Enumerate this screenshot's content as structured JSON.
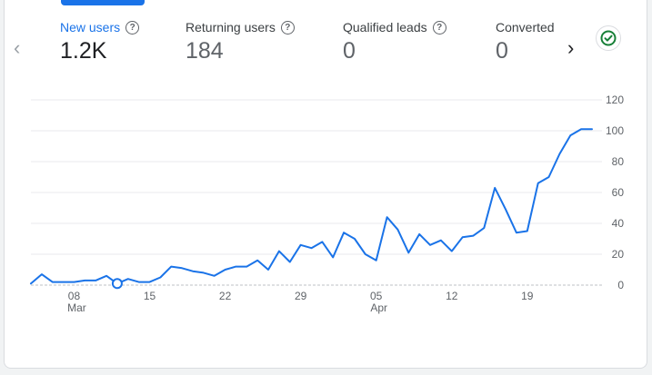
{
  "tabs": [
    {
      "label": "New users",
      "value": "1.2K",
      "active": true
    },
    {
      "label": "Returning users",
      "value": "184",
      "active": false
    },
    {
      "label": "Qualified leads",
      "value": "0",
      "active": false
    },
    {
      "label": "Converted",
      "value": "0",
      "active": false
    }
  ],
  "icons": {
    "prev": "chevron-left-icon",
    "next": "chevron-right-icon",
    "help": "help-circle-icon",
    "status": "check-circle-icon"
  },
  "colors": {
    "accent": "#1a73e8",
    "status": "#188038",
    "grid": "#e8eaed"
  },
  "chart_data": {
    "type": "line",
    "title": "",
    "xlabel": "",
    "ylabel": "",
    "ylim": [
      0,
      120
    ],
    "yticks": [
      0,
      20,
      40,
      60,
      80,
      100,
      120
    ],
    "y_axis_side": "right",
    "grid": true,
    "x": [
      "2024-03-04",
      "2024-03-05",
      "2024-03-06",
      "2024-03-07",
      "2024-03-08",
      "2024-03-09",
      "2024-03-10",
      "2024-03-11",
      "2024-03-12",
      "2024-03-13",
      "2024-03-14",
      "2024-03-15",
      "2024-03-16",
      "2024-03-17",
      "2024-03-18",
      "2024-03-19",
      "2024-03-20",
      "2024-03-21",
      "2024-03-22",
      "2024-03-23",
      "2024-03-24",
      "2024-03-25",
      "2024-03-26",
      "2024-03-27",
      "2024-03-28",
      "2024-03-29",
      "2024-03-30",
      "2024-03-31",
      "2024-04-01",
      "2024-04-02",
      "2024-04-03",
      "2024-04-04",
      "2024-04-05",
      "2024-04-06",
      "2024-04-07",
      "2024-04-08",
      "2024-04-09",
      "2024-04-10",
      "2024-04-11",
      "2024-04-12",
      "2024-04-13",
      "2024-04-14",
      "2024-04-15",
      "2024-04-16",
      "2024-04-17",
      "2024-04-18",
      "2024-04-19",
      "2024-04-20",
      "2024-04-21",
      "2024-04-22",
      "2024-04-23",
      "2024-04-24",
      "2024-04-25"
    ],
    "x_tick_labels": [
      {
        "date": "2024-03-08",
        "label": "08",
        "sublabel": "Mar"
      },
      {
        "date": "2024-03-15",
        "label": "15",
        "sublabel": ""
      },
      {
        "date": "2024-03-22",
        "label": "22",
        "sublabel": ""
      },
      {
        "date": "2024-03-29",
        "label": "29",
        "sublabel": ""
      },
      {
        "date": "2024-04-05",
        "label": "05",
        "sublabel": "Apr"
      },
      {
        "date": "2024-04-12",
        "label": "12",
        "sublabel": ""
      },
      {
        "date": "2024-04-19",
        "label": "19",
        "sublabel": ""
      }
    ],
    "series": [
      {
        "values": [
          1,
          7,
          2,
          2,
          2,
          3,
          3,
          6,
          1,
          4,
          2,
          2,
          5,
          12,
          11,
          9,
          8,
          6,
          10,
          12,
          12,
          16,
          10,
          22,
          15,
          26,
          24,
          28,
          18,
          34,
          30,
          20,
          16,
          44,
          36,
          21,
          33,
          26,
          29,
          22,
          31,
          32,
          37,
          63,
          49,
          34,
          35,
          66,
          70,
          85,
          97,
          101,
          101
        ],
        "color": "#1a73e8"
      }
    ],
    "highlight_point": {
      "date": "2024-03-12",
      "value": 1
    }
  }
}
